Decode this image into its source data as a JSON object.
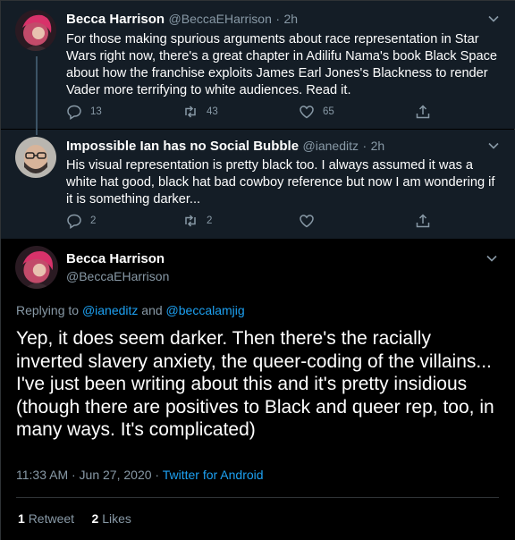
{
  "tweet1": {
    "name": "Becca Harrison",
    "handle": "@BeccaEHarrison",
    "sep": "·",
    "time": "2h",
    "text": "For those making spurious arguments about race representation in Star Wars right now, there's a great chapter in Adilifu Nama's book Black Space about how the franchise exploits James Earl Jones's Blackness to render Vader more terrifying to white audiences. Read it.",
    "replies": "13",
    "retweets": "43",
    "likes": "65"
  },
  "tweet2": {
    "name": "Impossible Ian has no Social Bubble",
    "handle": "@ianeditz",
    "sep": "·",
    "time": "2h",
    "text": "His visual representation is pretty black too. I always assumed it was a white hat good, black hat bad cowboy reference but now I am wondering if it is something darker...",
    "replies": "2",
    "retweets": "2"
  },
  "main": {
    "name": "Becca Harrison",
    "handle": "@BeccaEHarrison",
    "replying_prefix": "Replying to",
    "reply_user1": "@ianeditz",
    "reply_and": "and",
    "reply_user2": "@beccalamjig",
    "text": "Yep, it does seem darker. Then there's the racially inverted slavery anxiety, the queer-coding of the villains... I've just been writing about this and it's pretty insidious (though there are positives to Black and queer rep, too, in many ways. It's complicated)",
    "time": "11:33 AM · Jun 27, 2020 ·",
    "source": "Twitter for Android",
    "retweet_count": "1",
    "retweet_label": "Retweet",
    "like_count": "2",
    "like_label": "Likes"
  },
  "colors": {
    "accent": "#1da1f2",
    "secondary_text": "#8899a6",
    "thread_bg": "#141d26"
  }
}
